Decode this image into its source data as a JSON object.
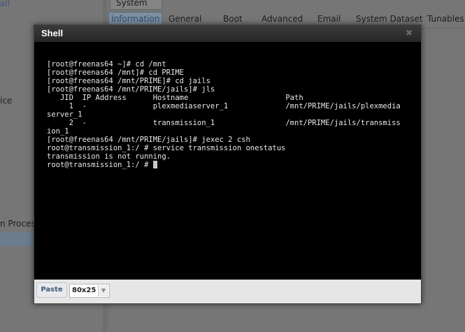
{
  "background": {
    "left_link": "all",
    "left_texts": [
      "ice",
      "n Process"
    ],
    "system_tab": "System",
    "tabs": [
      {
        "label": "Information",
        "active": true
      },
      {
        "label": "General",
        "active": false
      },
      {
        "label": "Boot",
        "active": false
      },
      {
        "label": "Advanced",
        "active": false
      },
      {
        "label": "Email",
        "active": false
      },
      {
        "label": "System Dataset",
        "active": false
      },
      {
        "label": "Tunables",
        "active": false
      }
    ]
  },
  "dialog": {
    "title": "Shell",
    "close_icon": "close-icon",
    "terminal_lines": [
      "[root@freenas64 ~]# cd /mnt",
      "[root@freenas64 /mnt]# cd PRIME",
      "[root@freenas64 /mnt/PRIME]# cd jails",
      "[root@freenas64 /mnt/PRIME/jails]# jls",
      "   JID  IP Address      Hostname                      Path",
      "     1  -               plexmediaserver_1             /mnt/PRIME/jails/plexmedia",
      "server_1",
      "     2  -               transmission_1                /mnt/PRIME/jails/transmiss",
      "ion_1",
      "[root@freenas64 /mnt/PRIME/jails]# jexec 2 csh",
      "root@transmission_1:/ # service transmission onestatus",
      "transmission is not running.",
      "root@transmission_1:/ # "
    ],
    "paste_label": "Paste",
    "size_value": "80x25"
  },
  "colors": {
    "terminal_bg": "#000000",
    "terminal_fg": "#e8e8e8",
    "titlebar": "#2c2c2c",
    "active_tab": "#2e4c75"
  }
}
